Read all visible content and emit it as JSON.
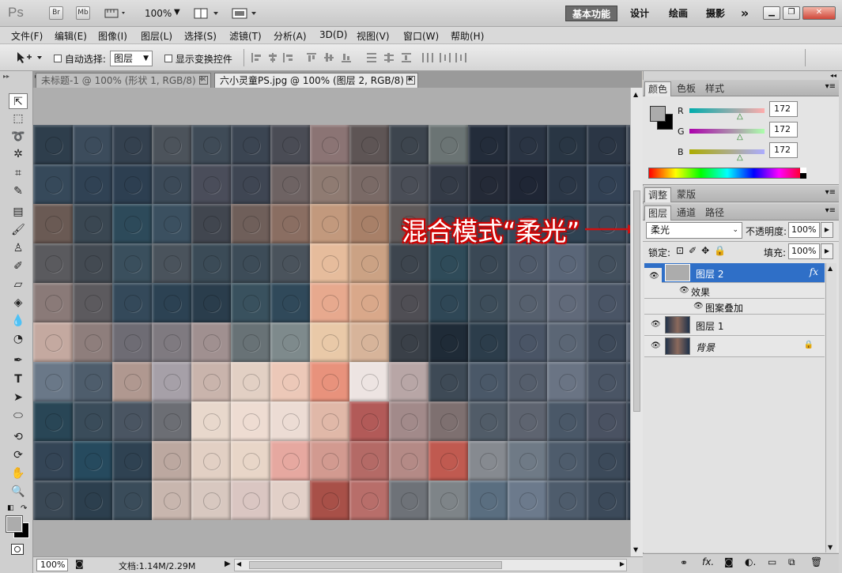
{
  "app": {
    "logo": "Ps",
    "bridge": "Br",
    "mini_bridge": "Mb",
    "zoom": "100%"
  },
  "workspaces": [
    "基本功能",
    "设计",
    "绘画",
    "摄影"
  ],
  "more": "»",
  "menus": [
    "文件(F)",
    "编辑(E)",
    "图像(I)",
    "图层(L)",
    "选择(S)",
    "滤镜(T)",
    "分析(A)",
    "3D(D)",
    "视图(V)",
    "窗口(W)",
    "帮助(H)"
  ],
  "options": {
    "auto_select_label": "自动选择:",
    "auto_select_value": "图层",
    "show_transform_label": "显示变换控件"
  },
  "tabs": [
    {
      "label": "未标题-1 @ 100% (形状 1, RGB/8) *",
      "close": "✕"
    },
    {
      "label": "六小灵童PS.jpg @ 100% (图层 2, RGB/8) *",
      "close": "✕"
    }
  ],
  "annotation": "混合模式“柔光”",
  "mosaic": {
    "cols": 16,
    "rows": 10,
    "colors": [
      "#2e3e4c",
      "#3c4c5c",
      "#34414f",
      "#4c535b",
      "#3f4b57",
      "#3b4552",
      "#4a4c55",
      "#8b7474",
      "#5e5555",
      "#3d454e",
      "#6b7474",
      "#232c3a",
      "#2a3443",
      "#293644",
      "#2b3645",
      "#3b4452",
      "#36495a",
      "#304254",
      "#2d3f51",
      "#3c4a58",
      "#4a4d5a",
      "#3f4653",
      "#6e6363",
      "#8f7b72",
      "#7a6a66",
      "#4a4e57",
      "#343b47",
      "#242a37",
      "#1f2635",
      "#2b3747",
      "#324154",
      "#243042",
      "#6a5a54",
      "#3a4752",
      "#2d4a5a",
      "#3b5060",
      "#41464f",
      "#6f5f5a",
      "#8a6e62",
      "#c2997d",
      "#a88068",
      "#5f5a5a",
      "#3a4654",
      "#304352",
      "#33495a",
      "#2f4252",
      "#3c4a5a",
      "#2e3c4c",
      "#5a5a5e",
      "#434a52",
      "#3a4f5d",
      "#4a535c",
      "#3b4b57",
      "#3d4c58",
      "#4a535c",
      "#e6bc9c",
      "#cba284",
      "#3d454e",
      "#2f4b59",
      "#3a4855",
      "#4f5a6a",
      "#5a6678",
      "#43505e",
      "#4a5263",
      "#8a7a78",
      "#5c5a5e",
      "#34495a",
      "#2c4253",
      "#2a3d4c",
      "#39515e",
      "#30495a",
      "#e7a98e",
      "#d9a88a",
      "#4f4e54",
      "#2f4756",
      "#3d4d5a",
      "#56606e",
      "#616a7a",
      "#4a5566",
      "#3a4555",
      "#c4a9a0",
      "#8e7e7c",
      "#6e6c74",
      "#7f7a80",
      "#a09090",
      "#687276",
      "#7e8a8c",
      "#e9c9a8",
      "#d7b49a",
      "#3a4048",
      "#1f2b37",
      "#2c3d4b",
      "#4a5566",
      "#5b6675",
      "#3e4a5a",
      "#566070",
      "#6a7888",
      "#4e5d6c",
      "#b09890",
      "#a6a0a8",
      "#c9b4ac",
      "#e2d0c4",
      "#ecc8b8",
      "#e8927c",
      "#ede4e2",
      "#b8a6a6",
      "#3e4a56",
      "#4a5868",
      "#555e6c",
      "#6a7484",
      "#4a5565",
      "#3d4a5b",
      "#294656",
      "#3a4c5a",
      "#4a5562",
      "#6c6e74",
      "#e8d8cc",
      "#eedcd2",
      "#ecdcd4",
      "#e0b8a8",
      "#b25a58",
      "#a28a8a",
      "#7e7070",
      "#515c68",
      "#5e6470",
      "#4a5868",
      "#4a5262",
      "#2e3b4a",
      "#344556",
      "#264a5e",
      "#2f4252",
      "#bca8a0",
      "#e2d0c4",
      "#e8d6c8",
      "#e6a8a0",
      "#d29a90",
      "#b46a66",
      "#b48a86",
      "#c05a50",
      "#868a90",
      "#6f7a86",
      "#4e5c6c",
      "#3c4a5a",
      "#232d3c",
      "#3a4855",
      "#2c3f4e",
      "#3a4c5a",
      "#c8b6ae",
      "#d8c8c0",
      "#dac6c2",
      "#e2d0c8",
      "#a85048",
      "#b86e6a",
      "#6e7278",
      "#7e8488",
      "#5a6e80",
      "#6c7a8c",
      "#4e5c6c",
      "#3c4a5a",
      "#2e3b4a"
    ]
  },
  "status": {
    "zoom": "100%",
    "doc": "文档:1.14M/2.29M"
  },
  "color_panel": {
    "tabs": [
      "颜色",
      "色板",
      "样式"
    ],
    "channels": [
      {
        "label": "R",
        "value": "172"
      },
      {
        "label": "G",
        "value": "172"
      },
      {
        "label": "B",
        "value": "172"
      }
    ],
    "slider_level": 0.67,
    "fg_color": "#acacac"
  },
  "adjust_panel": {
    "tabs": [
      "调整",
      "蒙版"
    ]
  },
  "layers_panel": {
    "tabs": [
      "图层",
      "通道",
      "路径"
    ],
    "blend_mode": "柔光",
    "opacity_label": "不透明度:",
    "opacity": "100%",
    "lock_label": "锁定:",
    "fill_label": "填充:",
    "fill": "100%",
    "layers": [
      {
        "name": "图层 2",
        "fx": "fx",
        "selected": true
      },
      {
        "name": "效果",
        "sub": true
      },
      {
        "name": "图案叠加",
        "sub": true
      },
      {
        "name": "图层 1"
      },
      {
        "name": "背景",
        "locked": true
      }
    ]
  },
  "colors": {
    "accent": "#2f6fc7",
    "annotation": "#cc1111"
  }
}
